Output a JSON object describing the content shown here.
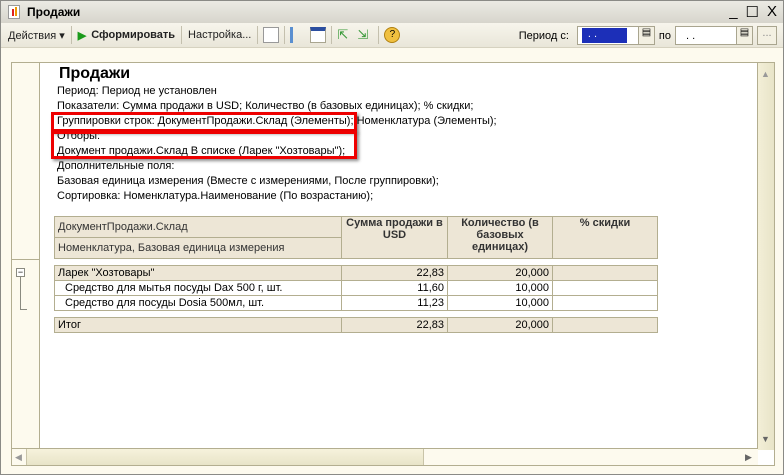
{
  "window": {
    "title": "Продажи",
    "minimize": "_",
    "maximize": "☐",
    "close": "X"
  },
  "toolbar": {
    "actions": "Действия ▾",
    "generate": "Сформировать",
    "settings": "Настройка...",
    "period_from_label": "Период с:",
    "period_from_value": ". .",
    "period_to_label": "по",
    "period_to_value": ". .",
    "more": "..."
  },
  "report": {
    "title": "Продажи",
    "lines": [
      "Период: Период не установлен",
      "Показатели: Сумма продажи в USD; Количество (в базовых единицах); % скидки;",
      "Группировки строк: ДокументПродажи.Склад (Элементы); Номенклатура (Элементы);",
      "Отборы:",
      "Документ продажи.Склад В списке (Ларек \"Хозтовары\");",
      "Дополнительные поля:",
      "Базовая единица измерения (Вместе с измерениями, После группировки);",
      "Сортировка: Номенклатура.Наименование (По возрастанию);"
    ],
    "table": {
      "header1": "ДокументПродажи.Склад",
      "header2": "Номенклатура, Базовая единица измерения",
      "col_sum": "Сумма продажи в USD",
      "col_qty": "Количество (в базовых единицах)",
      "col_disc": "% скидки",
      "group": {
        "name": "Ларек \"Хозтовары\"",
        "sum": "22,83",
        "qty": "20,000",
        "disc": ""
      },
      "rows": [
        {
          "name": "Средство для мытья посуды Dax 500 г, шт.",
          "sum": "11,60",
          "qty": "10,000",
          "disc": ""
        },
        {
          "name": "Средство для посуды Dosia 500мл, шт.",
          "sum": "11,23",
          "qty": "10,000",
          "disc": ""
        }
      ],
      "total": {
        "name": "Итог",
        "sum": "22,83",
        "qty": "20,000",
        "disc": ""
      }
    }
  }
}
